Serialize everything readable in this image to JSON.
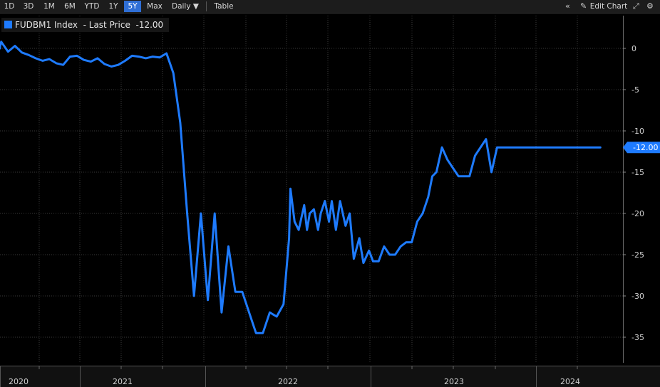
{
  "toolbar": {
    "periods": [
      "1D",
      "3D",
      "1M",
      "6M",
      "YTD",
      "1Y",
      "5Y",
      "Max"
    ],
    "active_period": "5Y",
    "frequency_label": "Daily ▼",
    "table_label": "Table",
    "edit_chart_label": "Edit Chart",
    "collapse_icon": "double-chevron-left-icon",
    "edit_icon": "pencil-icon",
    "expand_icon": "expand-arrow-icon",
    "settings_icon": "gear-icon"
  },
  "legend": {
    "text": "FUDBM1 Index  - Last Price  -12.00",
    "color": "#1e7bff"
  },
  "chart_data": {
    "type": "line",
    "title": "",
    "xlabel": "",
    "ylabel": "",
    "ylim": [
      -37.5,
      3
    ],
    "y_ticks": [
      0,
      -5,
      -10,
      -15,
      -20,
      -25,
      -30,
      -35
    ],
    "x_tick_labels": [
      "2020",
      "2021",
      "2022",
      "2023",
      "2024"
    ],
    "last_value_label": "-12.00",
    "grid": true,
    "legend_position": "top-left",
    "series_color": "#1e7bff",
    "series": [
      {
        "name": "FUDBM1 Index - Last Price",
        "x": [
          2019.75,
          2019.8,
          2019.85,
          2019.9,
          2019.95,
          2020.0,
          2020.05,
          2020.1,
          2020.15,
          2020.2,
          2020.25,
          2020.3,
          2020.35,
          2020.4,
          2020.45,
          2020.5,
          2020.55,
          2020.6,
          2020.65,
          2020.7,
          2020.75,
          2020.8,
          2020.85,
          2020.9,
          2020.95,
          2021.0,
          2021.05,
          2021.1,
          2021.15,
          2021.2,
          2021.25,
          2021.3,
          2021.35,
          2021.4,
          2021.45,
          2021.5,
          2021.55,
          2021.6,
          2021.65,
          2021.7,
          2021.75,
          2021.8,
          2021.85,
          2021.9,
          2021.95,
          2021.99,
          2022.0,
          2022.03,
          2022.06,
          2022.1,
          2022.12,
          2022.14,
          2022.17,
          2022.2,
          2022.22,
          2022.25,
          2022.28,
          2022.3,
          2022.33,
          2022.36,
          2022.4,
          2022.43,
          2022.46,
          2022.5,
          2022.53,
          2022.57,
          2022.6,
          2022.64,
          2022.68,
          2022.72,
          2022.76,
          2022.8,
          2022.84,
          2022.88,
          2022.92,
          2022.96,
          2023.0,
          2023.03,
          2023.06,
          2023.1,
          2023.14,
          2023.18,
          2023.22,
          2023.26,
          2023.3,
          2023.34,
          2023.38,
          2023.42,
          2023.46,
          2023.5,
          2023.55,
          2023.6,
          2023.65,
          2023.7,
          2023.75,
          2023.8,
          2023.9,
          2024.0,
          2024.1,
          2024.2,
          2024.25
        ],
        "y": [
          0.0,
          0.5,
          0.2,
          0.8,
          -0.4,
          0.3,
          -0.5,
          -0.8,
          -1.2,
          -1.5,
          -1.3,
          -1.8,
          -2.0,
          -1.0,
          -0.9,
          -1.4,
          -1.6,
          -1.2,
          -1.9,
          -2.2,
          -2.0,
          -1.5,
          -0.9,
          -1.0,
          -1.2,
          -1.0,
          -1.1,
          -0.6,
          -3.0,
          -9.0,
          -20.0,
          -30.0,
          -20.0,
          -30.5,
          -20.0,
          -32.0,
          -24.0,
          -29.5,
          -29.5,
          -32.0,
          -34.5,
          -34.5,
          -32.0,
          -32.5,
          -31.0,
          -23.0,
          -17.0,
          -21.0,
          -22.0,
          -19.0,
          -22.0,
          -20.0,
          -19.5,
          -22.0,
          -20.0,
          -18.5,
          -21.0,
          -18.5,
          -22.0,
          -18.5,
          -21.5,
          -20.0,
          -25.5,
          -23.0,
          -26.0,
          -24.5,
          -25.8,
          -25.8,
          -24.0,
          -25.0,
          -25.0,
          -24.0,
          -23.5,
          -23.5,
          -21.0,
          -20.0,
          -18.0,
          -15.5,
          -15.0,
          -12.0,
          -13.5,
          -14.5,
          -15.5,
          -15.5,
          -15.5,
          -13.0,
          -12.0,
          -11.0,
          -15.0,
          -12.0,
          -12.0,
          -12.0,
          -12.0,
          -12.0,
          -12.0,
          -12.0,
          -12.0,
          -12.0,
          -12.0,
          -12.0,
          -12.0
        ]
      }
    ]
  }
}
